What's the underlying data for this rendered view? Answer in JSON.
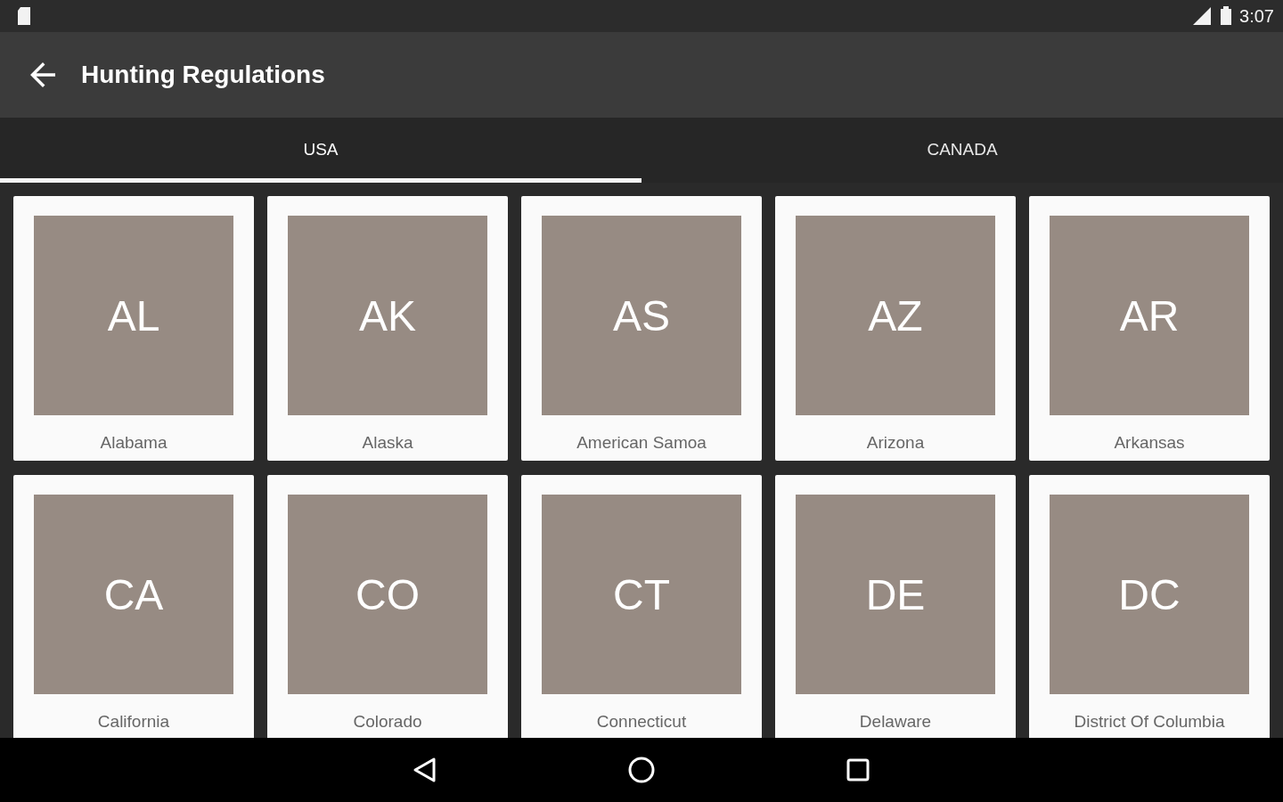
{
  "status_bar": {
    "time": "3:07"
  },
  "app_bar": {
    "title": "Hunting Regulations"
  },
  "tabs": [
    {
      "label": "USA",
      "selected": true
    },
    {
      "label": "CANADA",
      "selected": false
    }
  ],
  "states": [
    {
      "code": "AL",
      "name": "Alabama"
    },
    {
      "code": "AK",
      "name": "Alaska"
    },
    {
      "code": "AS",
      "name": "American Samoa"
    },
    {
      "code": "AZ",
      "name": "Arizona"
    },
    {
      "code": "AR",
      "name": "Arkansas"
    },
    {
      "code": "CA",
      "name": "California"
    },
    {
      "code": "CO",
      "name": "Colorado"
    },
    {
      "code": "CT",
      "name": "Connecticut"
    },
    {
      "code": "DE",
      "name": "Delaware"
    },
    {
      "code": "DC",
      "name": "District Of Columbia"
    }
  ]
}
